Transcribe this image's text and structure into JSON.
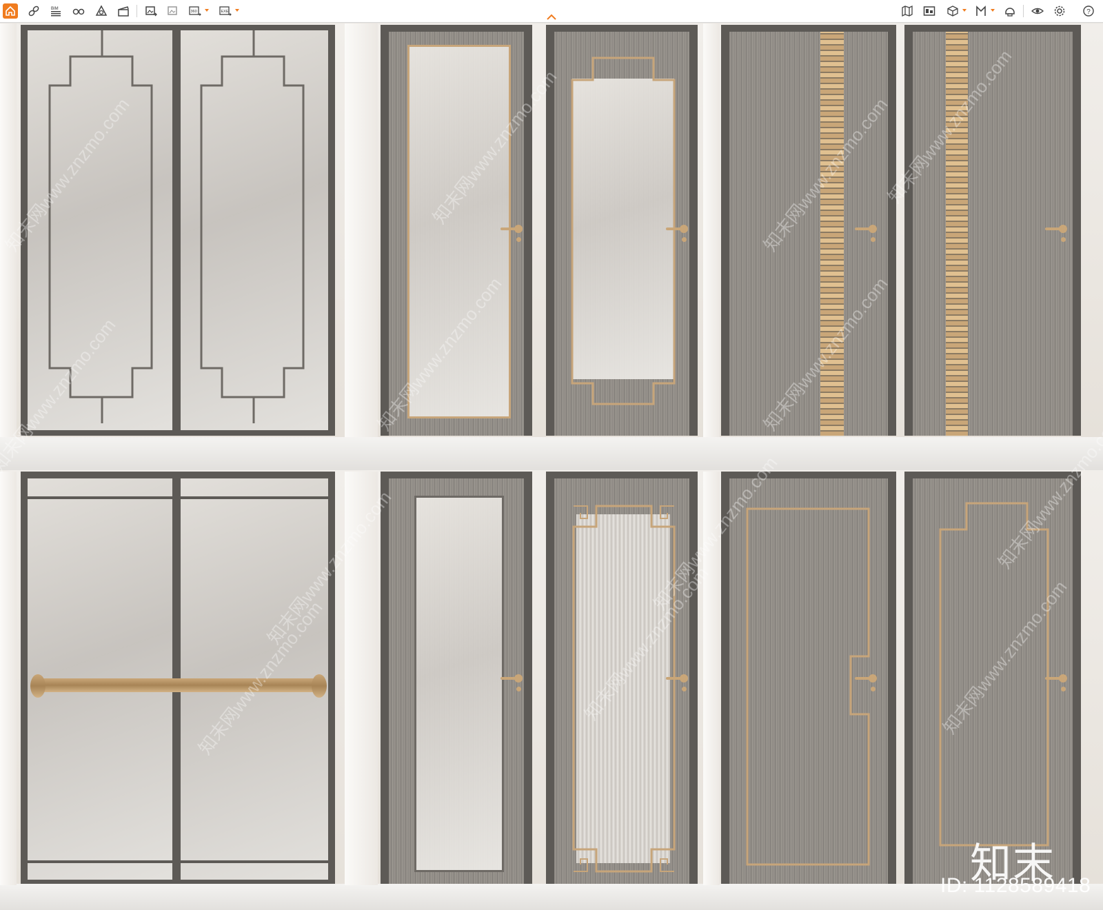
{
  "toolbar": {
    "left_tools": [
      {
        "icon": "home-icon"
      },
      {
        "icon": "link-icon"
      },
      {
        "icon": "bim-icon",
        "label": "BIM"
      },
      {
        "icon": "glasses-icon"
      },
      {
        "icon": "cone-icon"
      },
      {
        "icon": "clapper-icon"
      },
      {
        "icon": "image-export-icon"
      },
      {
        "icon": "image-batch-icon"
      },
      {
        "icon": "360-export-icon",
        "label": "360"
      },
      {
        "icon": "exe-export-icon",
        "label": "EXE"
      }
    ],
    "right_tools": [
      {
        "icon": "map-icon"
      },
      {
        "icon": "panel-icon"
      },
      {
        "icon": "cube-icon"
      },
      {
        "icon": "person-icon"
      },
      {
        "icon": "helmet-icon"
      },
      {
        "icon": "eye-icon"
      },
      {
        "icon": "settings-icon"
      },
      {
        "icon": "help-icon"
      }
    ],
    "accent_color": "#f07c1f"
  },
  "scene": {
    "watermark_text": "知末网www.znzmo.com",
    "brand_logo": "知末",
    "asset_id": "ID: 1128589418"
  },
  "colors": {
    "wall": "#ebe6e0",
    "frame": "#5d5a56",
    "brass": "#c9a678"
  }
}
